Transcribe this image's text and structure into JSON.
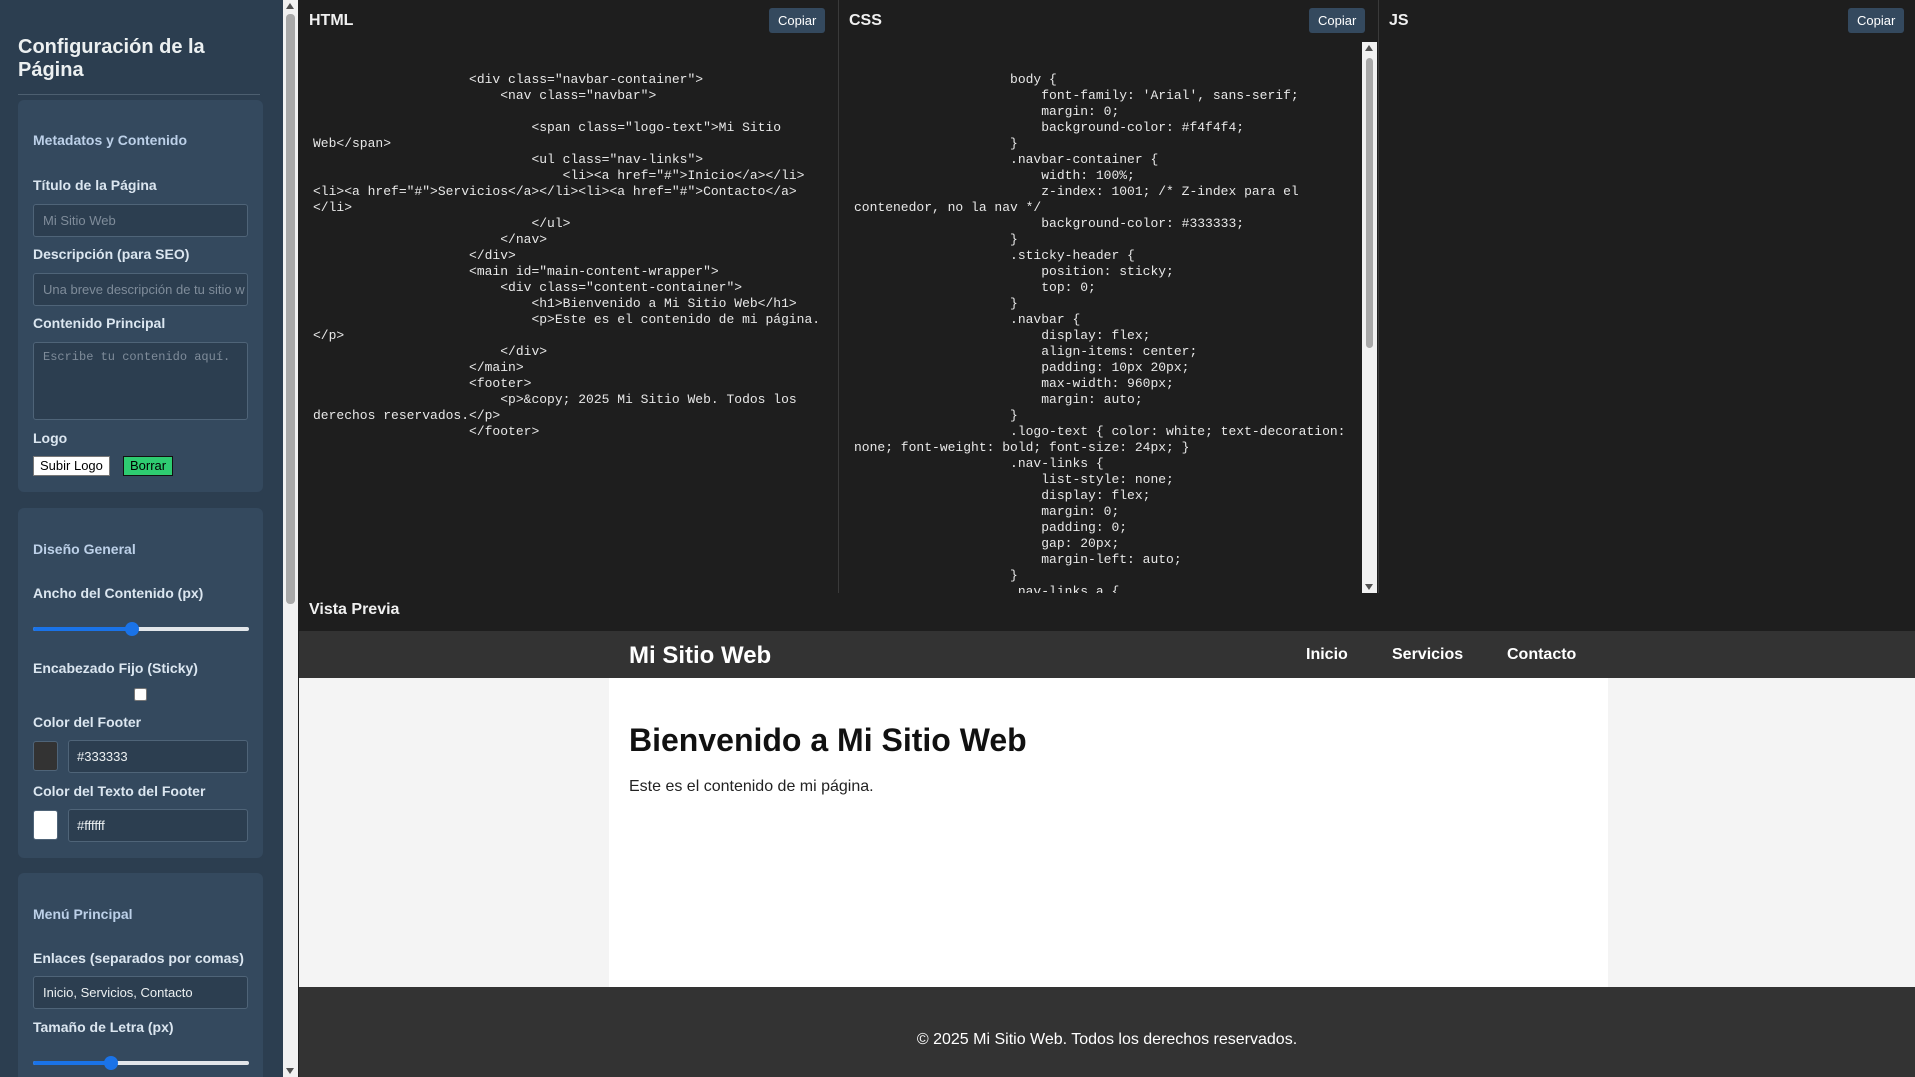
{
  "sidebar": {
    "title": "Configuración de la Página",
    "sections": {
      "meta": {
        "title": "Metadatos y Contenido",
        "page_title_label": "Título de la Página",
        "page_title_placeholder": "Mi Sitio Web",
        "description_label": "Descripción (para SEO)",
        "description_placeholder": "Una breve descripción de tu sitio w",
        "content_label": "Contenido Principal",
        "content_placeholder": "Escribe tu contenido aquí.",
        "logo_label": "Logo",
        "upload_logo_button": "Subir Logo",
        "clear_button": "Borrar"
      },
      "design": {
        "title": "Diseño General",
        "content_width_label": "Ancho del Contenido (px)",
        "content_width_slider_fraction": 0.46,
        "sticky_header_label": "Encabezado Fijo (Sticky)",
        "sticky_header_checked": false,
        "footer_color_label": "Color del Footer",
        "footer_color_value": "#333333",
        "footer_text_color_label": "Color del Texto del Footer",
        "footer_text_color_value": "#ffffff"
      },
      "menu": {
        "title": "Menú Principal",
        "links_label": "Enlaces (separados por comas)",
        "links_value": "Inicio, Servicios, Contacto",
        "font_size_label": "Tamaño de Letra (px)",
        "font_size_slider_fraction": 0.36
      }
    }
  },
  "panels": {
    "html": {
      "title": "HTML",
      "copy_label": "Copiar",
      "code": "                    <div class=\"navbar-container\">\n                        <nav class=\"navbar\">\n                            \n                            <span class=\"logo-text\">Mi Sitio Web</span>\n                            <ul class=\"nav-links\">\n                                <li><a href=\"#\">Inicio</a></li><li><a href=\"#\">Servicios</a></li><li><a href=\"#\">Contacto</a></li>\n                            </ul>\n                        </nav>\n                    </div>\n                    <main id=\"main-content-wrapper\">\n                        <div class=\"content-container\">\n                            <h1>Bienvenido a Mi Sitio Web</h1>\n                            <p>Este es el contenido de mi página.</p>\n                        </div>\n                    </main>\n                    <footer>\n                        <p>&copy; 2025 Mi Sitio Web. Todos los derechos reservados.</p>\n                    </footer>"
    },
    "css": {
      "title": "CSS",
      "copy_label": "Copiar",
      "code": "                    body {\n                        font-family: 'Arial', sans-serif;\n                        margin: 0;\n                        background-color: #f4f4f4;\n                    }\n                    .navbar-container {\n                        width: 100%;\n                        z-index: 1001; /* Z-index para el contenedor, no la nav */\n                        background-color: #333333;\n                    }\n                    .sticky-header {\n                        position: sticky;\n                        top: 0;\n                    }\n                    .navbar {\n                        display: flex;\n                        align-items: center;\n                        padding: 10px 20px;\n                        max-width: 960px;\n                        margin: auto;\n                    }\n                    .logo-text { color: white; text-decoration: none; font-weight: bold; font-size: 24px; }\n                    .nav-links {\n                        list-style: none;\n                        display: flex;\n                        margin: 0;\n                        padding: 0;\n                        gap: 20px;\n                        margin-left: auto;\n                    }\n                    .nav-links a {"
    },
    "js": {
      "title": "JS",
      "copy_label": "Copiar"
    }
  },
  "preview": {
    "label": "Vista Previa",
    "logo": "Mi Sitio Web",
    "nav_links": [
      "Inicio",
      "Servicios",
      "Contacto"
    ],
    "heading": "Bienvenido a Mi Sitio Web",
    "paragraph": "Este es el contenido de mi página.",
    "footer_text": "© 2025 Mi Sitio Web. Todos los derechos reservados."
  },
  "colors": {
    "sidebar_bg": "#2c3e50",
    "section_bg": "#34495e",
    "copy_button_bg": "#34495e",
    "clear_button_bg": "#2ecc71",
    "slider_accent": "#1a73e8",
    "preview_nav_bg": "#333333"
  }
}
